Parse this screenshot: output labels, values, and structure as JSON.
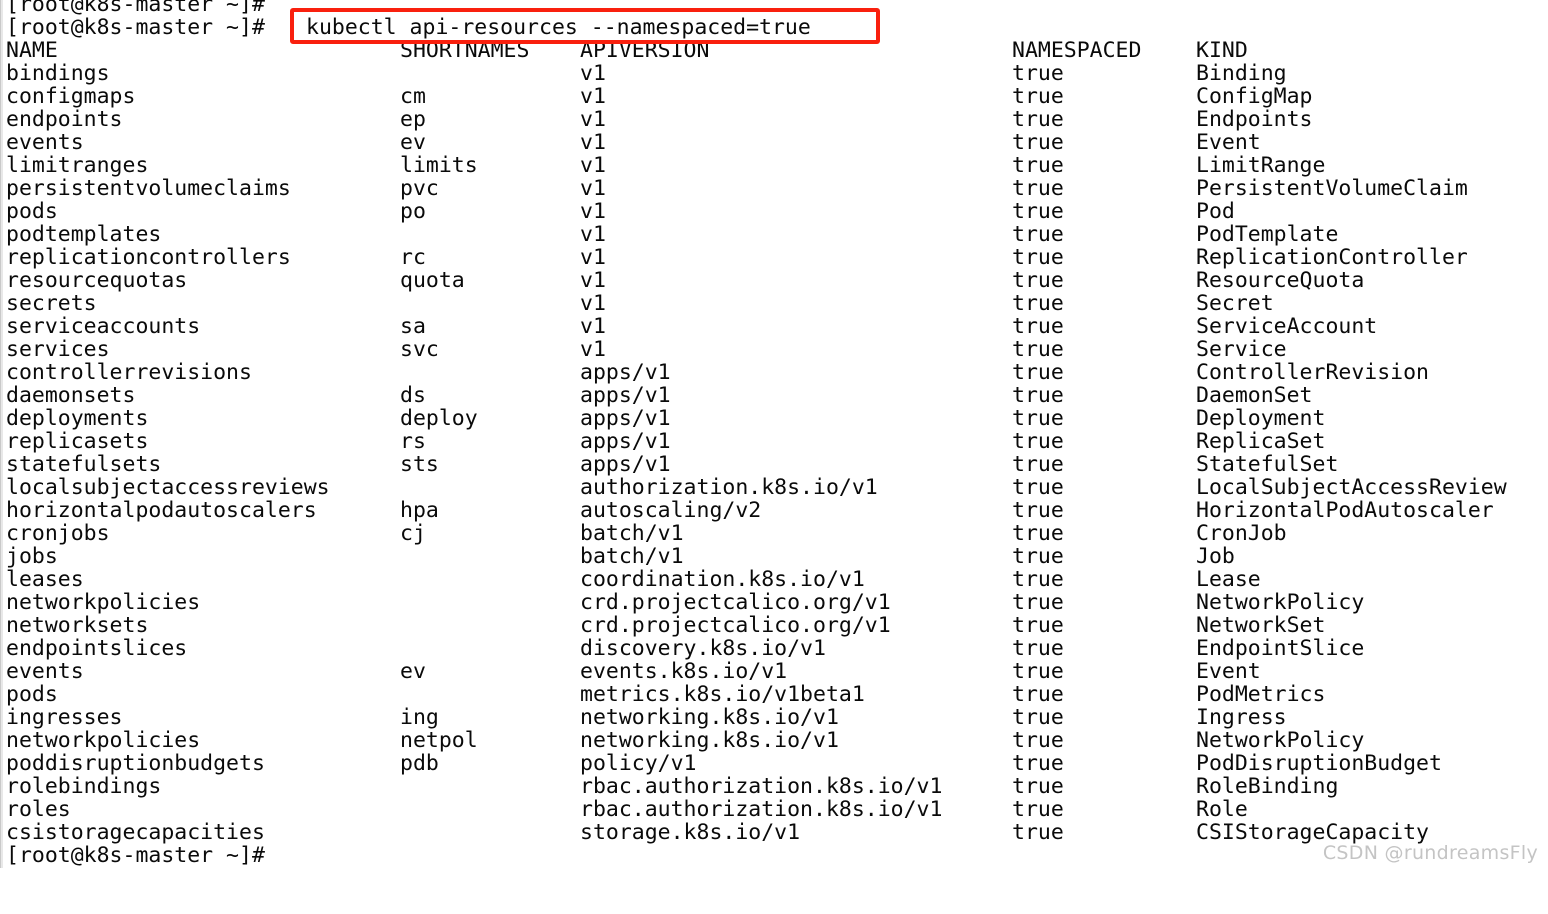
{
  "terminal": {
    "prompt": "[root@k8s-master ~]#",
    "command": "kubectl api-resources --namespaced=true",
    "highlight_color": "#f9200e",
    "background_color": "#ffffff",
    "text_color": "#0a0a0a",
    "trailing_prompt": "[root@k8s-master ~]#"
  },
  "table": {
    "headers": {
      "name": "NAME",
      "shortnames": "SHORTNAMES",
      "apiversion": "APIVERSION",
      "namespaced": "NAMESPACED",
      "kind": "KIND"
    },
    "rows": [
      {
        "name": "bindings",
        "shortnames": "",
        "apiversion": "v1",
        "namespaced": "true",
        "kind": "Binding"
      },
      {
        "name": "configmaps",
        "shortnames": "cm",
        "apiversion": "v1",
        "namespaced": "true",
        "kind": "ConfigMap"
      },
      {
        "name": "endpoints",
        "shortnames": "ep",
        "apiversion": "v1",
        "namespaced": "true",
        "kind": "Endpoints"
      },
      {
        "name": "events",
        "shortnames": "ev",
        "apiversion": "v1",
        "namespaced": "true",
        "kind": "Event"
      },
      {
        "name": "limitranges",
        "shortnames": "limits",
        "apiversion": "v1",
        "namespaced": "true",
        "kind": "LimitRange"
      },
      {
        "name": "persistentvolumeclaims",
        "shortnames": "pvc",
        "apiversion": "v1",
        "namespaced": "true",
        "kind": "PersistentVolumeClaim"
      },
      {
        "name": "pods",
        "shortnames": "po",
        "apiversion": "v1",
        "namespaced": "true",
        "kind": "Pod"
      },
      {
        "name": "podtemplates",
        "shortnames": "",
        "apiversion": "v1",
        "namespaced": "true",
        "kind": "PodTemplate"
      },
      {
        "name": "replicationcontrollers",
        "shortnames": "rc",
        "apiversion": "v1",
        "namespaced": "true",
        "kind": "ReplicationController"
      },
      {
        "name": "resourcequotas",
        "shortnames": "quota",
        "apiversion": "v1",
        "namespaced": "true",
        "kind": "ResourceQuota"
      },
      {
        "name": "secrets",
        "shortnames": "",
        "apiversion": "v1",
        "namespaced": "true",
        "kind": "Secret"
      },
      {
        "name": "serviceaccounts",
        "shortnames": "sa",
        "apiversion": "v1",
        "namespaced": "true",
        "kind": "ServiceAccount"
      },
      {
        "name": "services",
        "shortnames": "svc",
        "apiversion": "v1",
        "namespaced": "true",
        "kind": "Service"
      },
      {
        "name": "controllerrevisions",
        "shortnames": "",
        "apiversion": "apps/v1",
        "namespaced": "true",
        "kind": "ControllerRevision"
      },
      {
        "name": "daemonsets",
        "shortnames": "ds",
        "apiversion": "apps/v1",
        "namespaced": "true",
        "kind": "DaemonSet"
      },
      {
        "name": "deployments",
        "shortnames": "deploy",
        "apiversion": "apps/v1",
        "namespaced": "true",
        "kind": "Deployment"
      },
      {
        "name": "replicasets",
        "shortnames": "rs",
        "apiversion": "apps/v1",
        "namespaced": "true",
        "kind": "ReplicaSet"
      },
      {
        "name": "statefulsets",
        "shortnames": "sts",
        "apiversion": "apps/v1",
        "namespaced": "true",
        "kind": "StatefulSet"
      },
      {
        "name": "localsubjectaccessreviews",
        "shortnames": "",
        "apiversion": "authorization.k8s.io/v1",
        "namespaced": "true",
        "kind": "LocalSubjectAccessReview"
      },
      {
        "name": "horizontalpodautoscalers",
        "shortnames": "hpa",
        "apiversion": "autoscaling/v2",
        "namespaced": "true",
        "kind": "HorizontalPodAutoscaler"
      },
      {
        "name": "cronjobs",
        "shortnames": "cj",
        "apiversion": "batch/v1",
        "namespaced": "true",
        "kind": "CronJob"
      },
      {
        "name": "jobs",
        "shortnames": "",
        "apiversion": "batch/v1",
        "namespaced": "true",
        "kind": "Job"
      },
      {
        "name": "leases",
        "shortnames": "",
        "apiversion": "coordination.k8s.io/v1",
        "namespaced": "true",
        "kind": "Lease"
      },
      {
        "name": "networkpolicies",
        "shortnames": "",
        "apiversion": "crd.projectcalico.org/v1",
        "namespaced": "true",
        "kind": "NetworkPolicy"
      },
      {
        "name": "networksets",
        "shortnames": "",
        "apiversion": "crd.projectcalico.org/v1",
        "namespaced": "true",
        "kind": "NetworkSet"
      },
      {
        "name": "endpointslices",
        "shortnames": "",
        "apiversion": "discovery.k8s.io/v1",
        "namespaced": "true",
        "kind": "EndpointSlice"
      },
      {
        "name": "events",
        "shortnames": "ev",
        "apiversion": "events.k8s.io/v1",
        "namespaced": "true",
        "kind": "Event"
      },
      {
        "name": "pods",
        "shortnames": "",
        "apiversion": "metrics.k8s.io/v1beta1",
        "namespaced": "true",
        "kind": "PodMetrics"
      },
      {
        "name": "ingresses",
        "shortnames": "ing",
        "apiversion": "networking.k8s.io/v1",
        "namespaced": "true",
        "kind": "Ingress"
      },
      {
        "name": "networkpolicies",
        "shortnames": "netpol",
        "apiversion": "networking.k8s.io/v1",
        "namespaced": "true",
        "kind": "NetworkPolicy"
      },
      {
        "name": "poddisruptionbudgets",
        "shortnames": "pdb",
        "apiversion": "policy/v1",
        "namespaced": "true",
        "kind": "PodDisruptionBudget"
      },
      {
        "name": "rolebindings",
        "shortnames": "",
        "apiversion": "rbac.authorization.k8s.io/v1",
        "namespaced": "true",
        "kind": "RoleBinding"
      },
      {
        "name": "roles",
        "shortnames": "",
        "apiversion": "rbac.authorization.k8s.io/v1",
        "namespaced": "true",
        "kind": "Role"
      },
      {
        "name": "csistoragecapacities",
        "shortnames": "",
        "apiversion": "storage.k8s.io/v1",
        "namespaced": "true",
        "kind": "CSIStorageCapacity"
      }
    ]
  },
  "watermark": {
    "text": "CSDN @rundreamsFly"
  }
}
